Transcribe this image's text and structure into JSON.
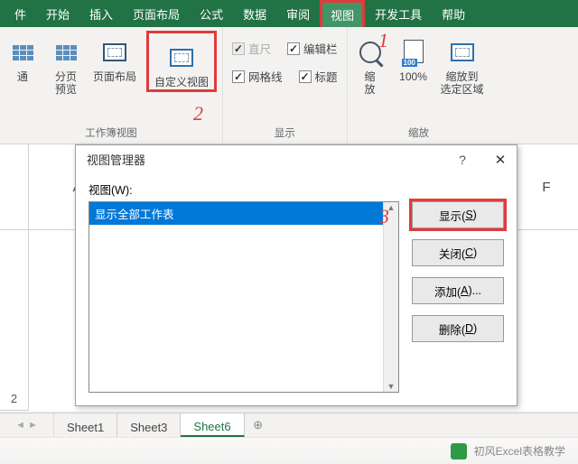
{
  "ribbon": {
    "tabs": [
      "件",
      "开始",
      "插入",
      "页面布局",
      "公式",
      "数据",
      "审阅",
      "视图",
      "开发工具",
      "帮助"
    ],
    "active_tab_index": 7,
    "group1_label": "工作簿视图",
    "group2_label": "显示",
    "group3_label": "缩放",
    "btn_normal": "通",
    "btn_pagebreak": "分页\n预览",
    "btn_pagelayout": "页面布局",
    "btn_customview": "自定义视图",
    "chk_ruler": "直尺",
    "chk_formulabar": "编辑栏",
    "chk_gridlines": "网格线",
    "chk_headings": "标题",
    "btn_zoom": "缩\n放",
    "btn_100": "100%",
    "btn_zoomsel": "缩放到\n选定区域"
  },
  "annotations": {
    "a1": "1",
    "a2": "2",
    "a3": "3"
  },
  "grid": {
    "col_a": "A",
    "col_f": "F",
    "row_2": "2"
  },
  "dialog": {
    "title": "视图管理器",
    "label": "视图(W):",
    "item": "显示全部工作表",
    "btn_show": "显示(S)",
    "btn_close": "关闭(C)",
    "btn_add": "添加(A)...",
    "btn_delete": "删除(D)"
  },
  "sheets": {
    "s1": "Sheet1",
    "s3": "Sheet3",
    "s6": "Sheet6"
  },
  "watermark": "初风Excel表格教学"
}
